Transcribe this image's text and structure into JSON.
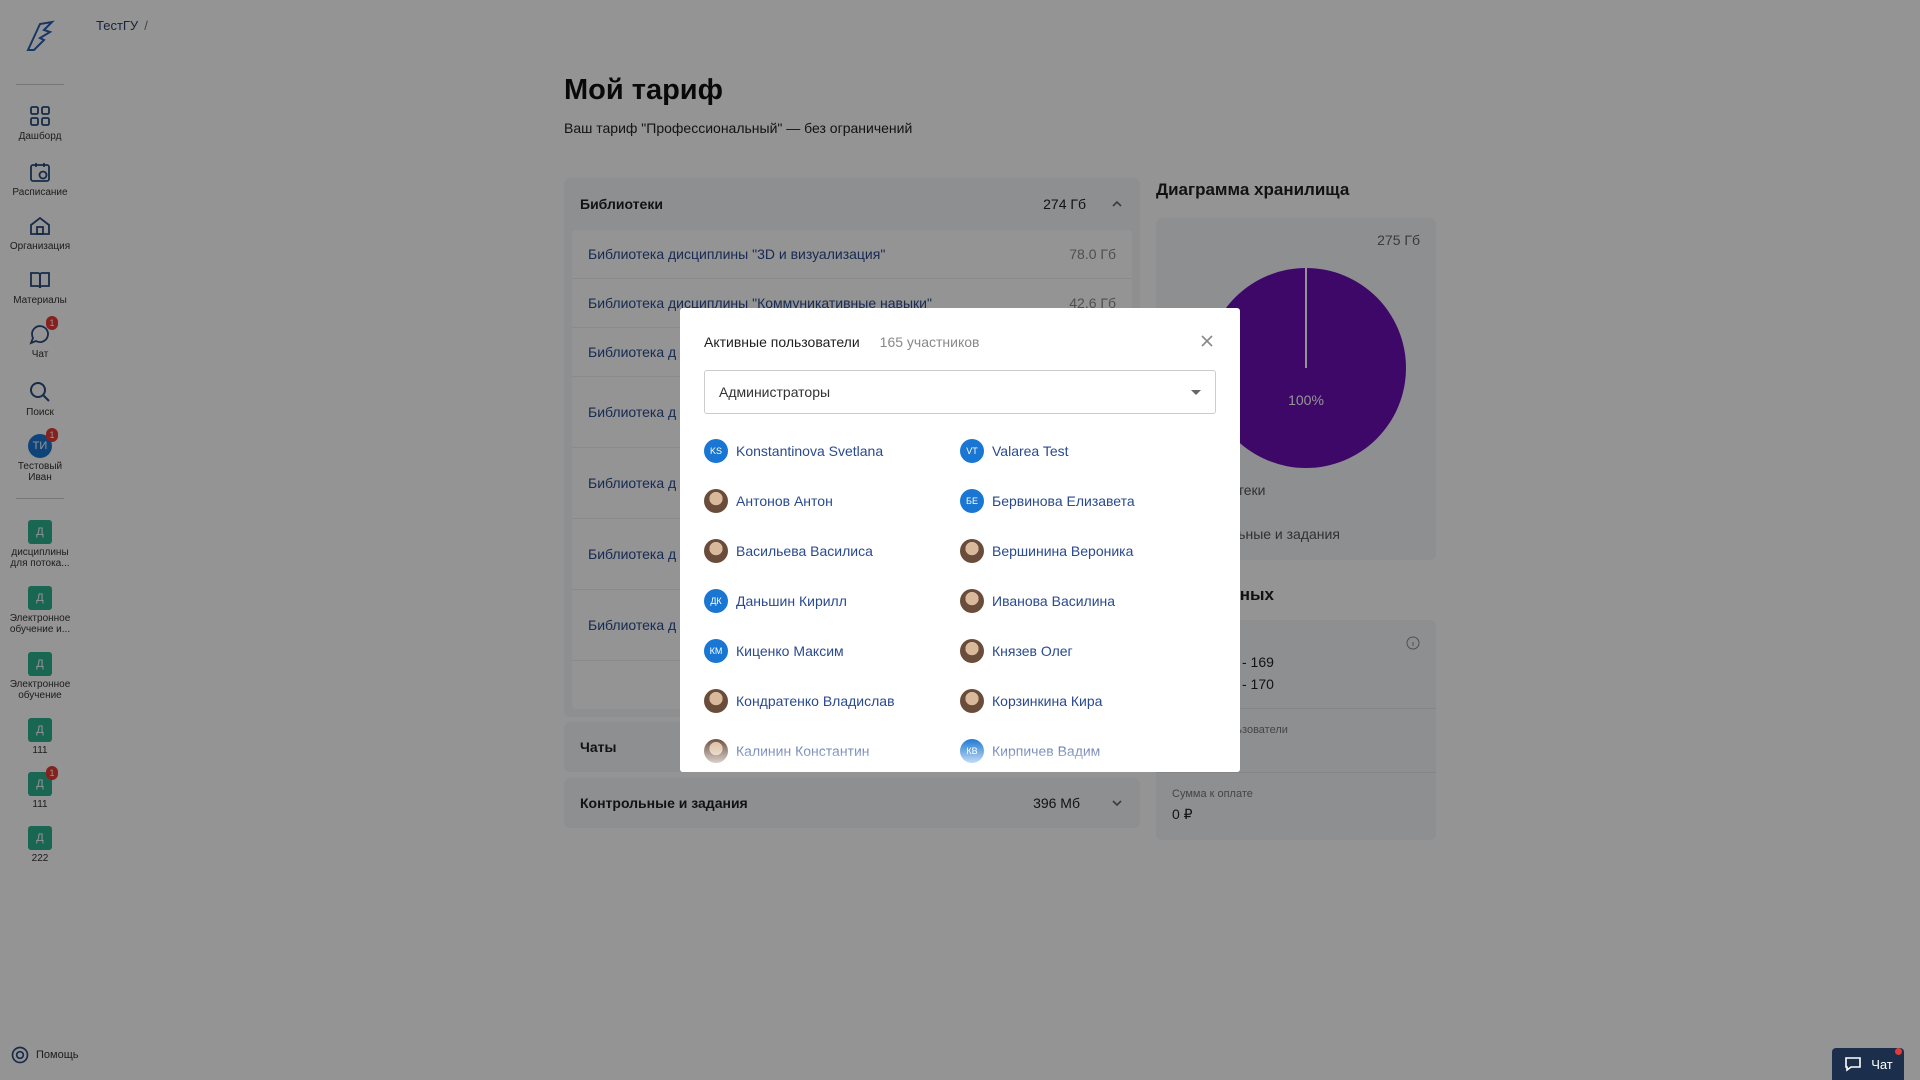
{
  "breadcrumb": {
    "root": "ТестГУ",
    "sep": "/"
  },
  "sidebar": {
    "items": [
      {
        "label": "Дашборд",
        "icon": "grid-icon"
      },
      {
        "label": "Расписание",
        "icon": "calendar-icon"
      },
      {
        "label": "Организация",
        "icon": "building-icon"
      },
      {
        "label": "Материалы",
        "icon": "book-icon"
      },
      {
        "label": "Чат",
        "icon": "chat-icon",
        "badge": "1"
      },
      {
        "label": "Поиск",
        "icon": "search-icon"
      }
    ],
    "user": {
      "initials": "ТИ",
      "label": "Тестовый Иван",
      "badge": "1"
    },
    "courses": [
      {
        "letter": "Д",
        "label": "дисциплины для потока..."
      },
      {
        "letter": "Д",
        "label": "Электронное обучение и..."
      },
      {
        "letter": "Д",
        "label": "Электронное обучение"
      },
      {
        "letter": "Д",
        "label": "111"
      },
      {
        "letter": "Д",
        "label": "111",
        "badge": "1"
      },
      {
        "letter": "Д",
        "label": "222"
      }
    ],
    "help": "Помощь"
  },
  "page": {
    "title": "Мой тариф",
    "subtitle": "Ваш тариф \"Профессиональный\" — без ограничений"
  },
  "libraries": {
    "header": "Библиотеки",
    "size": "274 Гб",
    "items": [
      {
        "name": "Библиотека дисциплины \"3D и визуализация\"",
        "size": "78.0 Гб"
      },
      {
        "name": "Библиотека дисциплины \"Коммуникативные навыки\"",
        "size": "42.6 Гб"
      },
      {
        "name": "Библиотека д",
        "size": ""
      },
      {
        "name": "Библиотека д психологичес",
        "size": ""
      },
      {
        "name": "Библиотека д мышление\"",
        "size": ""
      },
      {
        "name": "Библиотека д организация",
        "size": ""
      },
      {
        "name": "Библиотека д организация",
        "size": ""
      }
    ]
  },
  "chats": {
    "header": "Чаты"
  },
  "tasks": {
    "header": "Контрольные и задания",
    "size": "396 Мб"
  },
  "storage": {
    "title": "Диаграмма хранилища",
    "total": "275 Гб",
    "percent": "100%",
    "legend1": "отеки",
    "legend2": "льные и задания"
  },
  "data_section": {
    "title": "анных",
    "line1": "ли",
    "line2": "- 169",
    "line3": "- 170",
    "label2": "ользователи",
    "payment_label": "Сумма к оплате",
    "payment_value": "0 ₽"
  },
  "modal": {
    "title": "Активные пользователи",
    "count": "165 участников",
    "filter": "Администраторы",
    "users": [
      {
        "name": "Konstantinova Svetlana",
        "initials": "KS",
        "photo": false
      },
      {
        "name": "Valarea Test",
        "initials": "VT",
        "photo": false
      },
      {
        "name": "Антонов Антон",
        "initials": "",
        "photo": true
      },
      {
        "name": "Бервинова Елизавета",
        "initials": "БЕ",
        "photo": false
      },
      {
        "name": "Васильева Василиса",
        "initials": "",
        "photo": true
      },
      {
        "name": "Вершинина Вероника",
        "initials": "",
        "photo": true
      },
      {
        "name": "Даньшин Кирилл",
        "initials": "ДК",
        "photo": false
      },
      {
        "name": "Иванова Василина",
        "initials": "",
        "photo": true
      },
      {
        "name": "Киценко Максим",
        "initials": "КМ",
        "photo": false
      },
      {
        "name": "Князев Олег",
        "initials": "",
        "photo": true
      },
      {
        "name": "Кондратенко Владислав",
        "initials": "",
        "photo": true
      },
      {
        "name": "Корзинкина Кира",
        "initials": "",
        "photo": true
      },
      {
        "name": "Калинин Константин",
        "initials": "",
        "photo": true
      },
      {
        "name": "Кирпичев Вадим",
        "initials": "КВ",
        "photo": false
      }
    ]
  },
  "chat_button": {
    "label": "Чат"
  },
  "colors": {
    "accent": "#1976d2",
    "pie": "#6b0fb6",
    "course": "#2bb28f",
    "badge": "#e53935"
  }
}
